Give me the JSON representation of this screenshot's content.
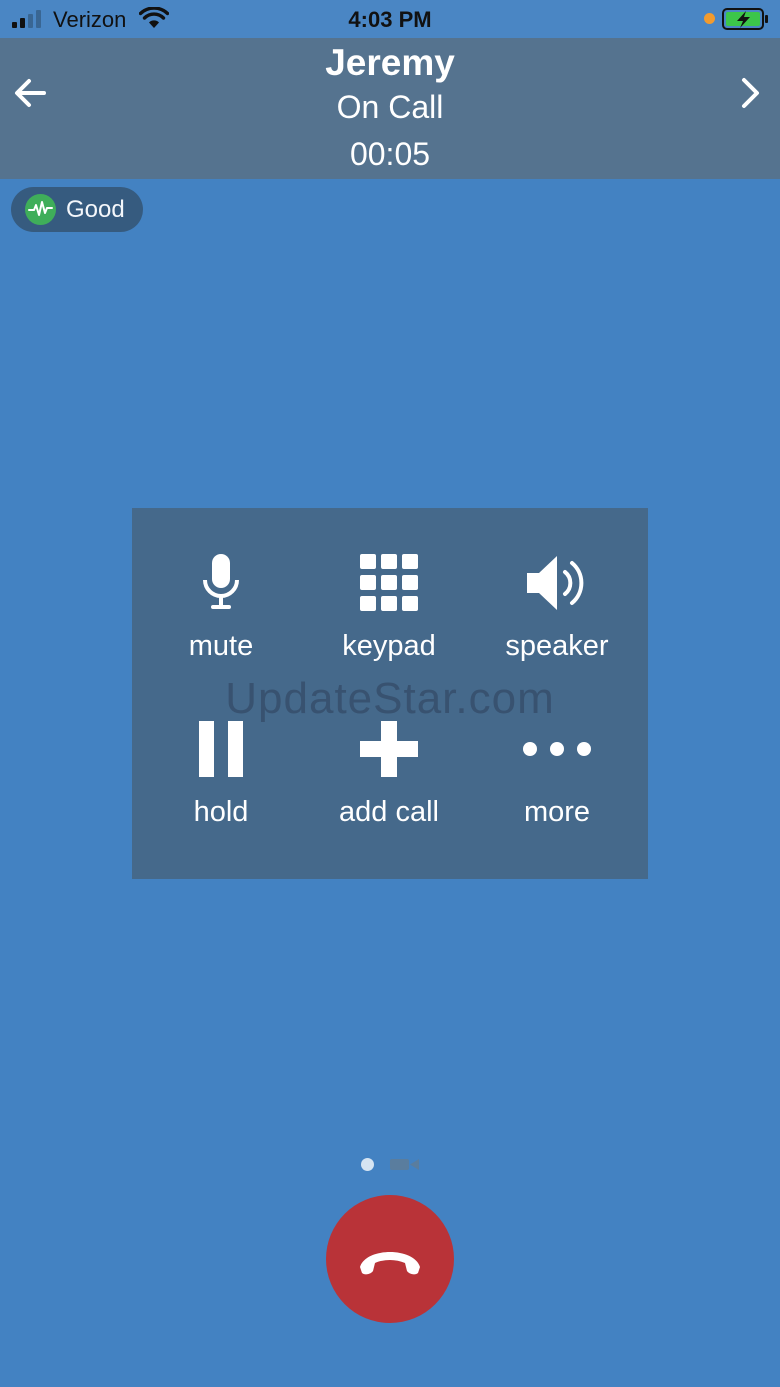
{
  "status_bar": {
    "carrier": "Verizon",
    "time": "4:03 PM",
    "icons": [
      "signal-icon",
      "wifi-icon",
      "orange-dot-icon",
      "battery-charging-icon"
    ]
  },
  "header": {
    "caller_name": "Jeremy",
    "call_state": "On Call",
    "timer": "00:05",
    "back_icon": "arrow-left-icon",
    "next_icon": "chevron-right-icon"
  },
  "quality": {
    "label": "Good",
    "icon": "pulse-icon",
    "color": "#3fae5a"
  },
  "controls": {
    "watermark": "UpdateStar.com",
    "items": [
      {
        "label": "mute",
        "icon": "microphone-icon"
      },
      {
        "label": "keypad",
        "icon": "keypad-icon"
      },
      {
        "label": "speaker",
        "icon": "speaker-icon"
      },
      {
        "label": "hold",
        "icon": "pause-icon"
      },
      {
        "label": "add call",
        "icon": "plus-icon"
      },
      {
        "label": "more",
        "icon": "more-dots-icon"
      }
    ]
  },
  "pager": {
    "dots": [
      "page-dot",
      "video-icon"
    ]
  },
  "end_call": {
    "icon": "hang-up-icon",
    "color": "#b93338"
  },
  "colors": {
    "background": "#4382c2",
    "header": "#55738f",
    "panel": "#45698b"
  }
}
